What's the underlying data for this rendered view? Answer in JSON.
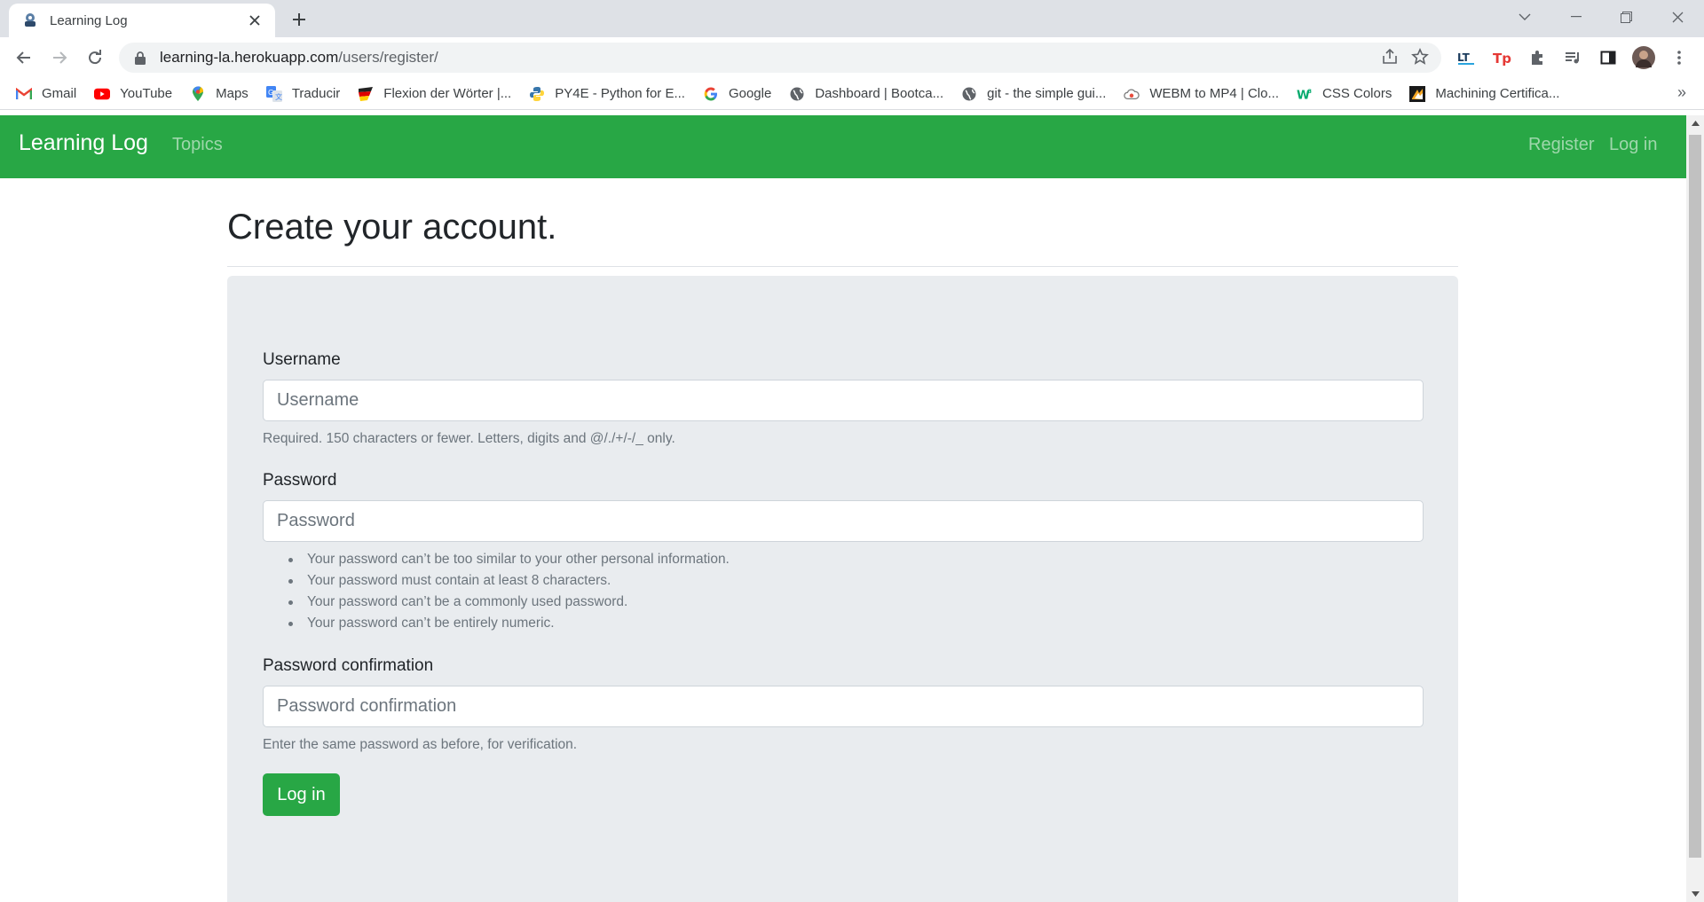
{
  "browser": {
    "tab": {
      "title": "Learning Log",
      "favicon": "django-pony-icon"
    },
    "url": {
      "host": "learning-la.herokuapp.com",
      "path": "/users/register/"
    },
    "bookmarks": [
      {
        "label": "Gmail",
        "icon": "gmail-icon",
        "color": "#ea4335"
      },
      {
        "label": "YouTube",
        "icon": "youtube-icon",
        "color": "#ff0000"
      },
      {
        "label": "Maps",
        "icon": "maps-icon",
        "color": "#34a853"
      },
      {
        "label": "Traducir",
        "icon": "translate-icon",
        "color": "#4285f4"
      },
      {
        "label": "Flexion der Wörter |...",
        "icon": "flag-de-icon",
        "color": "#dd0000"
      },
      {
        "label": "PY4E - Python for E...",
        "icon": "python-icon",
        "color": "#3776ab"
      },
      {
        "label": "Google",
        "icon": "google-icon",
        "color": "#4285f4"
      },
      {
        "label": "Dashboard | Bootca...",
        "icon": "globe-icon",
        "color": "#5f6368"
      },
      {
        "label": "git - the simple gui...",
        "icon": "globe-icon",
        "color": "#5f6368"
      },
      {
        "label": "WEBM to MP4 | Clo...",
        "icon": "cloud-icon",
        "color": "#e84c3d"
      },
      {
        "label": "CSS Colors",
        "icon": "w3schools-icon",
        "color": "#04aa6d"
      },
      {
        "label": "Machining Certifica...",
        "icon": "machining-icon",
        "color": "#f5a623"
      }
    ]
  },
  "navbar": {
    "brand": "Learning Log",
    "links": {
      "topics": "Topics",
      "register": "Register",
      "login": "Log in"
    },
    "color": "#28a745"
  },
  "page": {
    "title": "Create your account.",
    "form": {
      "username": {
        "label": "Username",
        "placeholder": "Username",
        "value": "",
        "help": "Required. 150 characters or fewer. Letters, digits and @/./+/-/_ only."
      },
      "password": {
        "label": "Password",
        "placeholder": "Password",
        "value": "",
        "help_items": [
          "Your password can’t be too similar to your other personal information.",
          "Your password must contain at least 8 characters.",
          "Your password can’t be a commonly used password.",
          "Your password can’t be entirely numeric."
        ]
      },
      "password_confirmation": {
        "label": "Password confirmation",
        "placeholder": "Password confirmation",
        "value": "",
        "help": "Enter the same password as before, for verification."
      },
      "submit_label": "Log in"
    }
  }
}
